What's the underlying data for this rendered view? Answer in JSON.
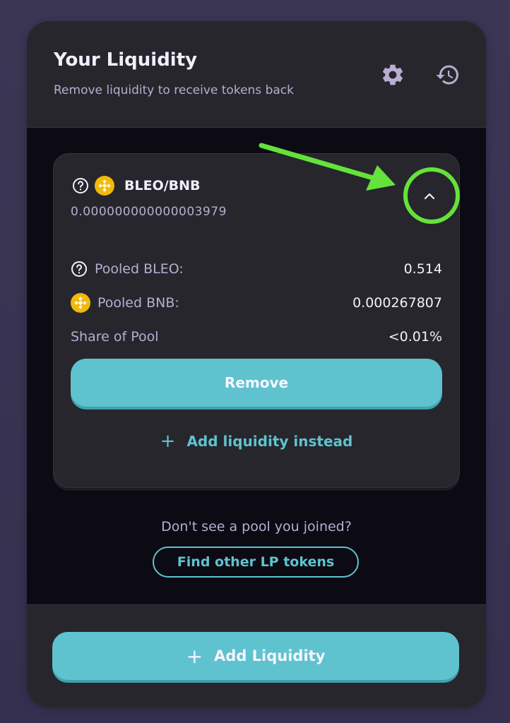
{
  "header": {
    "title": "Your Liquidity",
    "subtitle": "Remove liquidity to receive tokens back",
    "icons": [
      "gear-icon",
      "history-icon"
    ]
  },
  "position": {
    "pair": "BLEO/BNB",
    "lp_amount": "0.000000000000003979",
    "rows": [
      {
        "label": "Pooled BLEO:",
        "value": "0.514"
      },
      {
        "label": "Pooled BNB:",
        "value": "0.000267807"
      },
      {
        "label": "Share of Pool",
        "value": "<0.01%"
      }
    ],
    "remove_label": "Remove",
    "add_instead_label": "Add liquidity instead"
  },
  "help_text": "Don't see a pool you joined?",
  "find_label": "Find other LP tokens",
  "add_liquidity_label": "Add Liquidity",
  "colors": {
    "accent": "#5ec3cf",
    "card": "#27262c",
    "body": "#0c0a13",
    "annotation": "#64e33a"
  }
}
